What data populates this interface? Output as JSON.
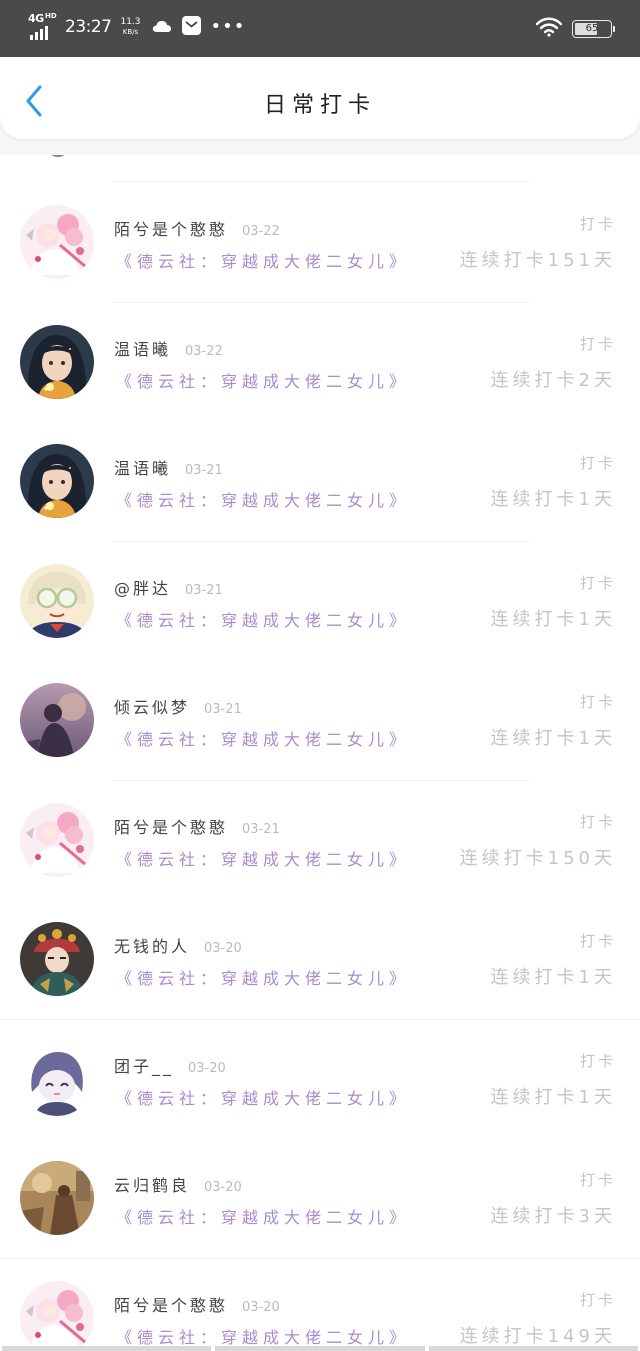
{
  "status_bar": {
    "network": "4G",
    "network_hd": "HD",
    "time": "23:27",
    "speed_value": "11.3",
    "speed_unit": "KB/s",
    "more": "•••",
    "battery": "65",
    "icons": [
      "signal-bars-icon",
      "cloud-icon",
      "mail-icon",
      "more-dots-icon",
      "wifi-icon",
      "battery-icon"
    ]
  },
  "header": {
    "title": "日常打卡",
    "back_icon": "chevron-left-icon",
    "accent_color": "#2f9be8"
  },
  "colors": {
    "book_title": "#a98ccf",
    "muted": "#c5c5c5"
  },
  "checkins": [
    {
      "user": "陌兮是个憨憨",
      "date": "03-22",
      "book": "《德云社：穿越成大佬二女儿》",
      "action": "打卡",
      "streak": "连续打卡151天",
      "avatar": "pink-anime-girl"
    },
    {
      "user": "温语曦",
      "date": "03-22",
      "book": "《德云社：穿越成大佬二女儿》",
      "action": "打卡",
      "streak": "连续打卡2天",
      "avatar": "dark-haired-girl"
    },
    {
      "user": "温语曦",
      "date": "03-21",
      "book": "《德云社：穿越成大佬二女儿》",
      "action": "打卡",
      "streak": "连续打卡1天",
      "avatar": "dark-haired-girl"
    },
    {
      "user": "@胖达",
      "date": "03-21",
      "book": "《德云社：穿越成大佬二女儿》",
      "action": "打卡",
      "streak": "连续打卡1天",
      "avatar": "goggles-character"
    },
    {
      "user": "倾云似梦",
      "date": "03-21",
      "book": "《德云社：穿越成大佬二女儿》",
      "action": "打卡",
      "streak": "连续打卡1天",
      "avatar": "sunset-figure"
    },
    {
      "user": "陌兮是个憨憨",
      "date": "03-21",
      "book": "《德云社：穿越成大佬二女儿》",
      "action": "打卡",
      "streak": "连续打卡150天",
      "avatar": "pink-anime-girl"
    },
    {
      "user": "无钱的人",
      "date": "03-20",
      "book": "《德云社：穿越成大佬二女儿》",
      "action": "打卡",
      "streak": "连续打卡1天",
      "avatar": "opera-costume"
    },
    {
      "user": "团子__",
      "date": "03-20",
      "book": "《德云社：穿越成大佬二女儿》",
      "action": "打卡",
      "streak": "连续打卡1天",
      "avatar": "purple-chibi"
    },
    {
      "user": "云归鹤良",
      "date": "03-20",
      "book": "《德云社：穿越成大佬二女儿》",
      "action": "打卡",
      "streak": "连续打卡3天",
      "avatar": "painting-scene"
    },
    {
      "user": "陌兮是个憨憨",
      "date": "03-20",
      "book": "《德云社：穿越成大佬二女儿》",
      "action": "打卡",
      "streak": "连续打卡149天",
      "avatar": "pink-anime-girl"
    }
  ]
}
